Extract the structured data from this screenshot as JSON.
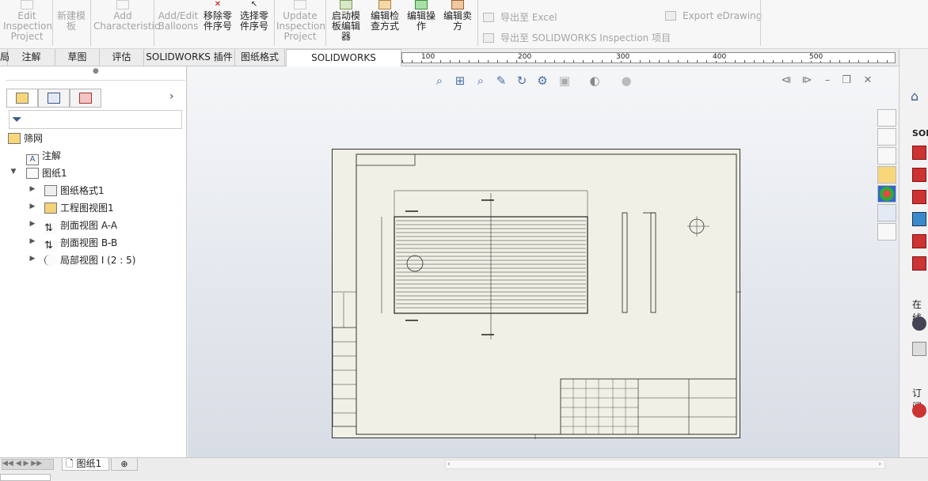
{
  "ribbon": {
    "buttons": [
      {
        "label": "Edit\nInspection\nProject",
        "disabled": true
      },
      {
        "label": "新建模\n板",
        "disabled": true
      },
      {
        "label": "Add\nCharacteristic",
        "disabled": true
      },
      {
        "label": "Add/Edit\nBalloons",
        "disabled": true
      },
      {
        "label": "移除零\n件序号",
        "disabled": false
      },
      {
        "label": "选择零\n件序号",
        "disabled": false
      },
      {
        "label": "Update\nInspection\nProject",
        "disabled": true
      },
      {
        "label": "启动模\n板编辑\n器",
        "disabled": false
      },
      {
        "label": "编辑检\n查方式",
        "disabled": false
      },
      {
        "label": "编辑操\n作",
        "disabled": false
      },
      {
        "label": "编辑卖\n方",
        "disabled": false
      }
    ],
    "export_excel": "导出至 Excel",
    "export_project": "导出至 SOLIDWORKS Inspection 项目",
    "export_edrawing": "Export eDrawing"
  },
  "tabs": [
    {
      "label": "局"
    },
    {
      "label": "注解"
    },
    {
      "label": "草图"
    },
    {
      "label": "评估"
    },
    {
      "label": "SOLIDWORKS 插件"
    },
    {
      "label": "图纸格式"
    },
    {
      "label": "SOLIDWORKS Inspection",
      "active": true
    }
  ],
  "ruler": {
    "labels": [
      "100",
      "200",
      "300",
      "400",
      "500"
    ]
  },
  "right_top": {
    "label": "SO"
  },
  "tree": {
    "root": "筛网",
    "items": [
      {
        "label": "注解",
        "level": 1
      },
      {
        "label": "图纸1",
        "level": 1,
        "expanded": true
      },
      {
        "label": "图纸格式1",
        "level": 2
      },
      {
        "label": "工程图视图1",
        "level": 2
      },
      {
        "label": "剖面视图 A-A",
        "level": 2
      },
      {
        "label": "剖面视图 B-B",
        "level": 2
      },
      {
        "label": "局部视图 I (2 : 5)",
        "level": 2
      }
    ]
  },
  "taskpane": {
    "sol_label": "SOL",
    "online_label": "在线",
    "subscribe_label": "订阅"
  },
  "sheet_tabs": {
    "active": "图纸1"
  },
  "colors": {
    "accent": "#4a6fa5",
    "sheet": "#f0f0e6"
  }
}
